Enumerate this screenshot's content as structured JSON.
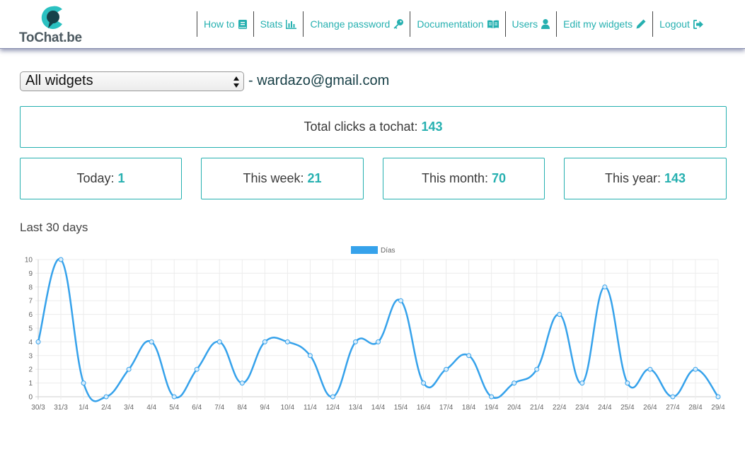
{
  "logo": {
    "brand": "ToChat.be"
  },
  "nav": [
    {
      "label": "How to",
      "icon": "book-icon"
    },
    {
      "label": "Stats",
      "icon": "bar-chart-icon"
    },
    {
      "label": "Change password",
      "icon": "key-icon"
    },
    {
      "label": "Documentation",
      "icon": "open-book-icon"
    },
    {
      "label": "Users",
      "icon": "user-icon"
    },
    {
      "label": "Edit my widgets",
      "icon": "pencil-icon"
    },
    {
      "label": "Logout",
      "icon": "logout-icon"
    }
  ],
  "widget_select": {
    "selected": "All widgets"
  },
  "email_line": "- wardazo@gmail.com",
  "totals": {
    "total": {
      "label": "Total clicks a tochat:",
      "value": "143"
    },
    "today": {
      "label": "Today:",
      "value": "1"
    },
    "week": {
      "label": "This week:",
      "value": "21"
    },
    "month": {
      "label": "This month:",
      "value": "70"
    },
    "year": {
      "label": "This year:",
      "value": "143"
    }
  },
  "colors": {
    "accent": "#26b0b0",
    "series": "#36a2eb"
  },
  "chart_heading": "Last 30 days",
  "chart_data": {
    "type": "line",
    "categories": [
      "30/3",
      "31/3",
      "1/4",
      "2/4",
      "3/4",
      "4/4",
      "5/4",
      "6/4",
      "7/4",
      "8/4",
      "9/4",
      "10/4",
      "11/4",
      "12/4",
      "13/4",
      "14/4",
      "15/4",
      "16/4",
      "17/4",
      "18/4",
      "19/4",
      "20/4",
      "21/4",
      "22/4",
      "23/4",
      "24/4",
      "25/4",
      "26/4",
      "27/4",
      "28/4",
      "29/4"
    ],
    "series": [
      {
        "name": "Días",
        "values": [
          4,
          10,
          1,
          0,
          2,
          4,
          0,
          2,
          4,
          1,
          4,
          4,
          3,
          0,
          4,
          4,
          7,
          1,
          2,
          3,
          0,
          1,
          2,
          6,
          1,
          8,
          1,
          2,
          0,
          2,
          0
        ]
      }
    ],
    "ylim": [
      0,
      10
    ],
    "yticks": [
      "0",
      "1",
      "2",
      "3",
      "4",
      "5",
      "6",
      "7",
      "8",
      "9",
      "10"
    ],
    "grid": true,
    "legend": "top-center",
    "xlabel": "",
    "ylabel": ""
  }
}
